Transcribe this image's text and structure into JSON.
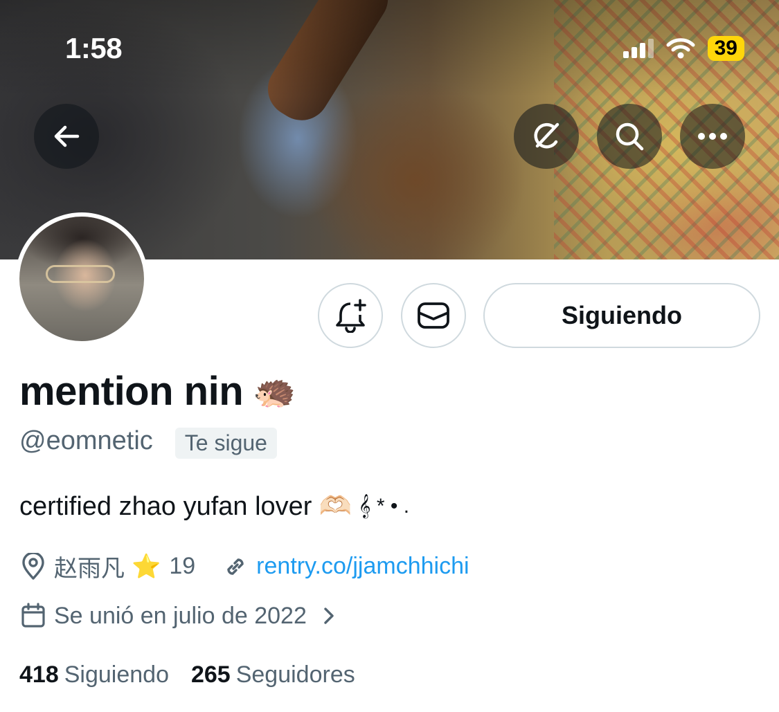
{
  "status_bar": {
    "time": "1:58",
    "battery": "39"
  },
  "header": {
    "back_icon": "arrow-left-icon",
    "grok_icon": "grok-icon",
    "search_icon": "search-icon",
    "more_icon": "more-icon"
  },
  "actions": {
    "notify_icon": "bell-plus-icon",
    "message_icon": "envelope-icon",
    "follow_label": "Siguiendo"
  },
  "profile": {
    "display_name": "mention nin",
    "name_emoji": "🦔",
    "handle": "@eomnetic",
    "follows_you": "Te sigue",
    "bio_text": "certified zhao yufan lover",
    "bio_emoji": "🫶🏻",
    "bio_suffix": "𝄞 * • .",
    "location": "赵雨凡",
    "location_emoji": "⭐",
    "location_number": "19",
    "website": "rentry.co/jjamchhichi",
    "joined": "Se unió en julio de 2022"
  },
  "stats": {
    "following_count": "418",
    "following_label": "Siguiendo",
    "followers_count": "265",
    "followers_label": "Seguidores"
  },
  "colors": {
    "link": "#1d9bf0",
    "secondary_text": "#536471",
    "primary_text": "#0f1419",
    "battery": "#ffd60a"
  }
}
